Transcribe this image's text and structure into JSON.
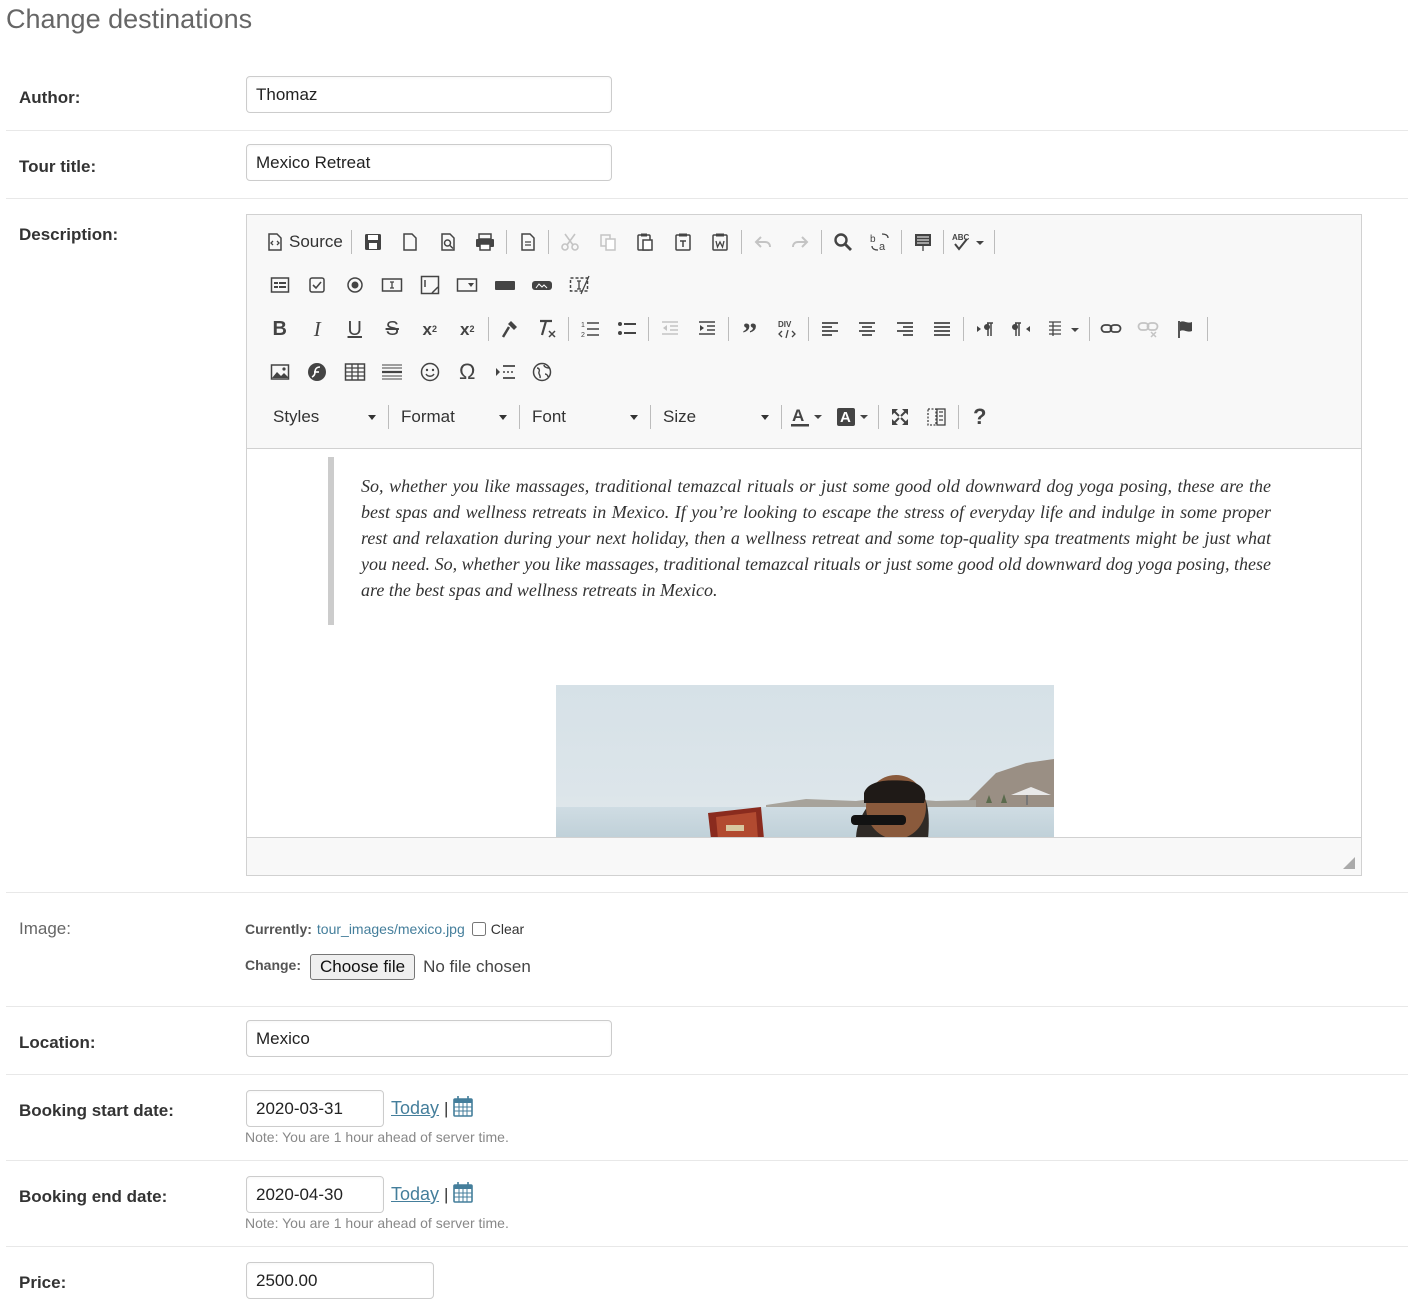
{
  "page": {
    "title": "Change destinations"
  },
  "fields": {
    "author": {
      "label": "Author:",
      "value": "Thomaz"
    },
    "tour_title": {
      "label": "Tour title:",
      "value": "Mexico Retreat"
    },
    "description": {
      "label": "Description:",
      "toolbar": {
        "source_label": "Source",
        "styles_label": "Styles",
        "format_label": "Format",
        "font_label": "Font",
        "size_label": "Size"
      },
      "quote_text": "So, whether you like massages, traditional temazcal rituals or just some good old downward dog yoga posing, these are the best spas and wellness retreats in Mexico. If you’re looking to escape the stress of everyday life and indulge in some proper rest and relaxation during your next holiday, then a wellness retreat and some top-quality spa treatments might be just what you need. So, whether you like massages, traditional temazcal rituals or just some good old downward dog yoga posing, these are the best spas and wellness retreats in Mexico."
    },
    "image": {
      "label": "Image:",
      "currently_label": "Currently:",
      "current_file": "tour_images/mexico.jpg",
      "clear_label": "Clear",
      "change_label": "Change:",
      "choose_file_label": "Choose file",
      "no_file_text": "No file chosen"
    },
    "location": {
      "label": "Location:",
      "value": "Mexico"
    },
    "booking_start_date": {
      "label": "Booking start date:",
      "value": "2020-03-31",
      "today_label": "Today",
      "separator": "|",
      "note": "Note: You are 1 hour ahead of server time."
    },
    "booking_end_date": {
      "label": "Booking end date:",
      "value": "2020-04-30",
      "today_label": "Today",
      "separator": "|",
      "note": "Note: You are 1 hour ahead of server time."
    },
    "price": {
      "label": "Price:",
      "value": "2500.00"
    }
  },
  "colors": {
    "link": "#447e9b",
    "label": "#333333",
    "note": "#888888"
  }
}
